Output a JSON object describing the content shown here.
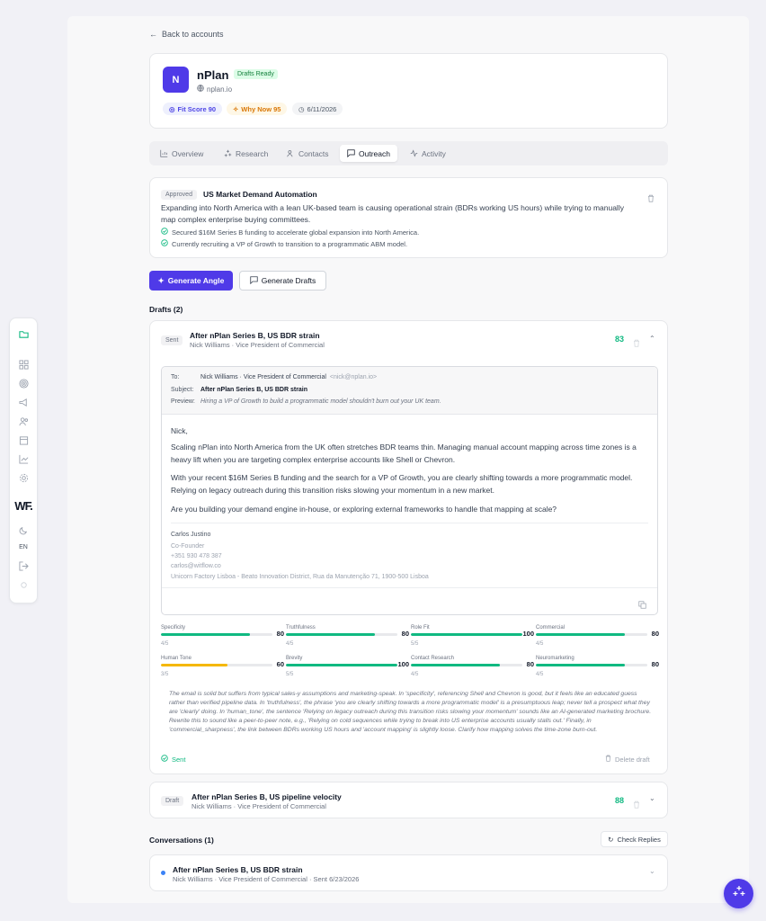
{
  "nav": {
    "back_label": "Back to accounts",
    "lang": "EN",
    "brand": "WF."
  },
  "account": {
    "initial": "N",
    "name": "nPlan",
    "status": "Drafts Ready",
    "domain": "nplan.io",
    "fit_score": "Fit Score 90",
    "why_now": "Why Now 95",
    "date": "6/11/2026"
  },
  "tabs": [
    "Overview",
    "Research",
    "Contacts",
    "Outreach",
    "Activity"
  ],
  "angle": {
    "badge": "Approved",
    "title": "US Market Demand Automation",
    "description": "Expanding into North America with a lean UK-based team is causing operational strain (BDRs working US hours) while trying to manually map complex enterprise buying committees.",
    "points": [
      "Secured $16M Series B funding to accelerate global expansion into North America.",
      "Currently recruiting a VP of Growth to transition to a programmatic ABM model."
    ]
  },
  "actions": {
    "generate_angle": "Generate Angle",
    "generate_drafts": "Generate Drafts"
  },
  "drafts_label": "Drafts (2)",
  "draft1": {
    "status": "Sent",
    "title": "After nPlan Series B, US BDR strain",
    "contact": "Nick Williams · Vice President of Commercial",
    "score": "83",
    "to_label": "To:",
    "to_value": "Nick Williams · Vice President of Commercial",
    "to_email": "<nick@nplan.io>",
    "subject_label": "Subject:",
    "subject_value": "After nPlan Series B, US BDR strain",
    "preview_label": "Preview:",
    "preview_value": "Hiring a VP of Growth to build a programmatic model shouldn't burn out your UK team.",
    "greeting": "Nick,",
    "p1": "Scaling nPlan into North America from the UK often stretches BDR teams thin. Managing manual account mapping across time zones is a heavy lift when you are targeting complex enterprise accounts like Shell or Chevron.",
    "p2": "With your recent $16M Series B funding and the search for a VP of Growth, you are clearly shifting towards a more programmatic model. Relying on legacy outreach during this transition risks slowing your momentum in a new market.",
    "p3": "Are you building your demand engine in-house, or exploring external frameworks to handle that mapping at scale?",
    "signature": {
      "name": "Carlos Justino",
      "role": "Co-Founder",
      "phone": "+351 930 478 387",
      "email": "carlos@witflow.co",
      "address": "Unicorn Factory Lisboa - Beato Innovation District, Rua da Manutenção 71, 1900-500 Lisboa"
    },
    "metrics": [
      {
        "label": "Specificity",
        "value": "80",
        "score": "4/5",
        "pct": 0.8,
        "color": "#10b981"
      },
      {
        "label": "Truthfulness",
        "value": "80",
        "score": "4/5",
        "pct": 0.8,
        "color": "#10b981"
      },
      {
        "label": "Role Fit",
        "value": "100",
        "score": "5/5",
        "pct": 1.0,
        "color": "#10b981"
      },
      {
        "label": "Commercial",
        "value": "80",
        "score": "4/5",
        "pct": 0.8,
        "color": "#10b981"
      },
      {
        "label": "Human Tone",
        "value": "60",
        "score": "3/5",
        "pct": 0.6,
        "color": "#f5b800"
      },
      {
        "label": "Brevity",
        "value": "100",
        "score": "5/5",
        "pct": 1.0,
        "color": "#10b981"
      },
      {
        "label": "Contact Research",
        "value": "80",
        "score": "4/5",
        "pct": 0.8,
        "color": "#10b981"
      },
      {
        "label": "Neuromarketing",
        "value": "80",
        "score": "4/5",
        "pct": 0.8,
        "color": "#10b981"
      }
    ],
    "critique": "The email is solid but suffers from typical sales-y assumptions and marketing-speak. In 'specificity', referencing Shell and Chevron is good, but it feels like an educated guess rather than verified pipeline data. In 'truthfulness', the phrase 'you are clearly shifting towards a more programmatic model' is a presumptuous leap; never tell a prospect what they are 'clearly' doing. In 'human_tone', the sentence 'Relying on legacy outreach during this transition risks slowing your momentum' sounds like an AI-generated marketing brochure. Rewrite this to sound like a peer-to-peer note, e.g., 'Relying on cold sequences while trying to break into US enterprise accounts usually stalls out.' Finally, in 'commercial_sharpness', the link between BDRs working US hours and 'account mapping' is slightly loose. Clarify how mapping solves the time-zone burn-out.",
    "sent_label": "Sent",
    "delete_label": "Delete draft"
  },
  "draft2": {
    "status": "Draft",
    "title": "After nPlan Series B, US pipeline velocity",
    "contact": "Nick Williams · Vice President of Commercial",
    "score": "88"
  },
  "conversations": {
    "label": "Conversations (1)",
    "check_label": "Check Replies",
    "item_title": "After nPlan Series B, US BDR strain",
    "item_meta": "Nick Williams · Vice President of Commercial · Sent 6/23/2026"
  },
  "colors": {
    "accent": "#4f3ae8",
    "success": "#10b981",
    "warning": "#f5b800"
  }
}
